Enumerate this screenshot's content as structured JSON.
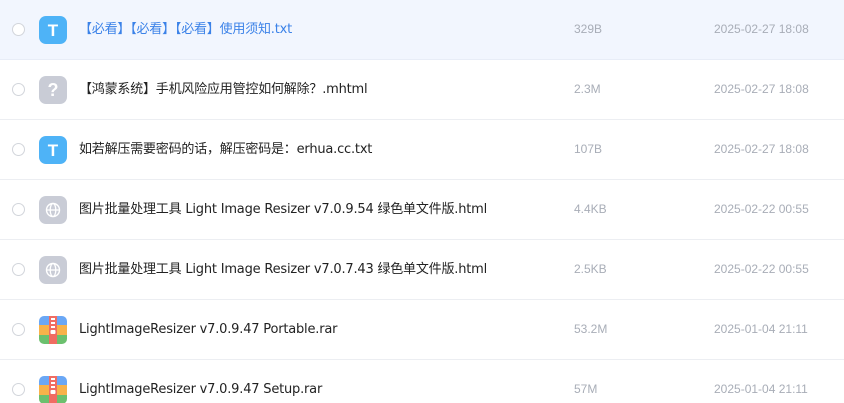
{
  "files": [
    {
      "name": "【必看】【必看】【必看】使用须知.txt",
      "size": "329B",
      "date": "2025-02-27 18:08",
      "icon": "txt-file-icon",
      "icon_glyph": "T",
      "hovered": true
    },
    {
      "name": "【鸿蒙系统】手机风险应用管控如何解除？.mhtml",
      "size": "2.3M",
      "date": "2025-02-27 18:08",
      "icon": "unknown-file-icon",
      "icon_glyph": "?",
      "hovered": false
    },
    {
      "name": "如若解压需要密码的话，解压密码是：erhua.cc.txt",
      "size": "107B",
      "date": "2025-02-27 18:08",
      "icon": "txt-file-icon",
      "icon_glyph": "T",
      "hovered": false
    },
    {
      "name": "图片批量处理工具 Light Image Resizer v7.0.9.54 绿色单文件版.html",
      "size": "4.4KB",
      "date": "2025-02-22 00:55",
      "icon": "globe-icon",
      "hovered": false
    },
    {
      "name": "图片批量处理工具 Light Image Resizer v7.0.7.43 绿色单文件版.html",
      "size": "2.5KB",
      "date": "2025-02-22 00:55",
      "icon": "globe-icon",
      "hovered": false
    },
    {
      "name": "LightImageResizer v7.0.9.47 Portable.rar",
      "size": "53.2M",
      "date": "2025-01-04 21:11",
      "icon": "archive-icon",
      "hovered": false
    },
    {
      "name": "LightImageResizer v7.0.9.47 Setup.rar",
      "size": "57M",
      "date": "2025-01-04 21:11",
      "icon": "archive-icon",
      "hovered": false
    }
  ],
  "colors": {
    "hover_bg": "#f2f6fe",
    "accent_text": "#3b82e8",
    "txt_icon": "#4eb3f7",
    "neutral_icon": "#c9ccd6",
    "meta_text": "#a8adb7"
  }
}
